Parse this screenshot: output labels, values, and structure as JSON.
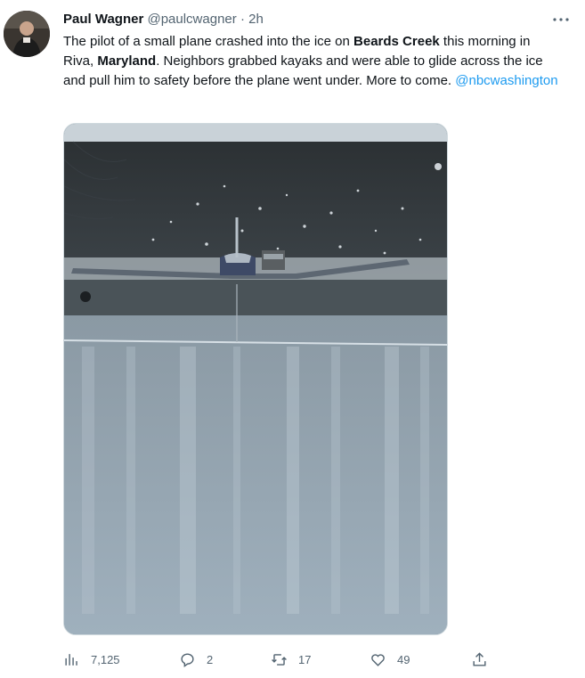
{
  "author": {
    "name": "Paul Wagner",
    "handle": "@paulcwagner",
    "separator": "·",
    "time": "2h"
  },
  "tweet": {
    "t1": "The pilot of a small plane crashed into the ice on ",
    "b1": "Beards Creek",
    "t2": " this morning in Riva, ",
    "b2": "Maryland",
    "t3": ". Neighbors grabbed kayaks and were able to glide across the ice and pull him to safety before the plane went under. More to come. ",
    "mention": "@nbcwashington"
  },
  "media": {
    "alt": "Small plane partially submerged in icy creek"
  },
  "actions": {
    "views": "7,125",
    "replies": "2",
    "retweets": "17",
    "likes": "49"
  },
  "icons": {
    "more": "more-icon",
    "views": "views-icon",
    "reply": "reply-icon",
    "retweet": "retweet-icon",
    "like": "like-icon",
    "share": "share-icon"
  },
  "colors": {
    "link": "#1d9bf0",
    "secondary": "#536471",
    "text": "#0f1419"
  }
}
